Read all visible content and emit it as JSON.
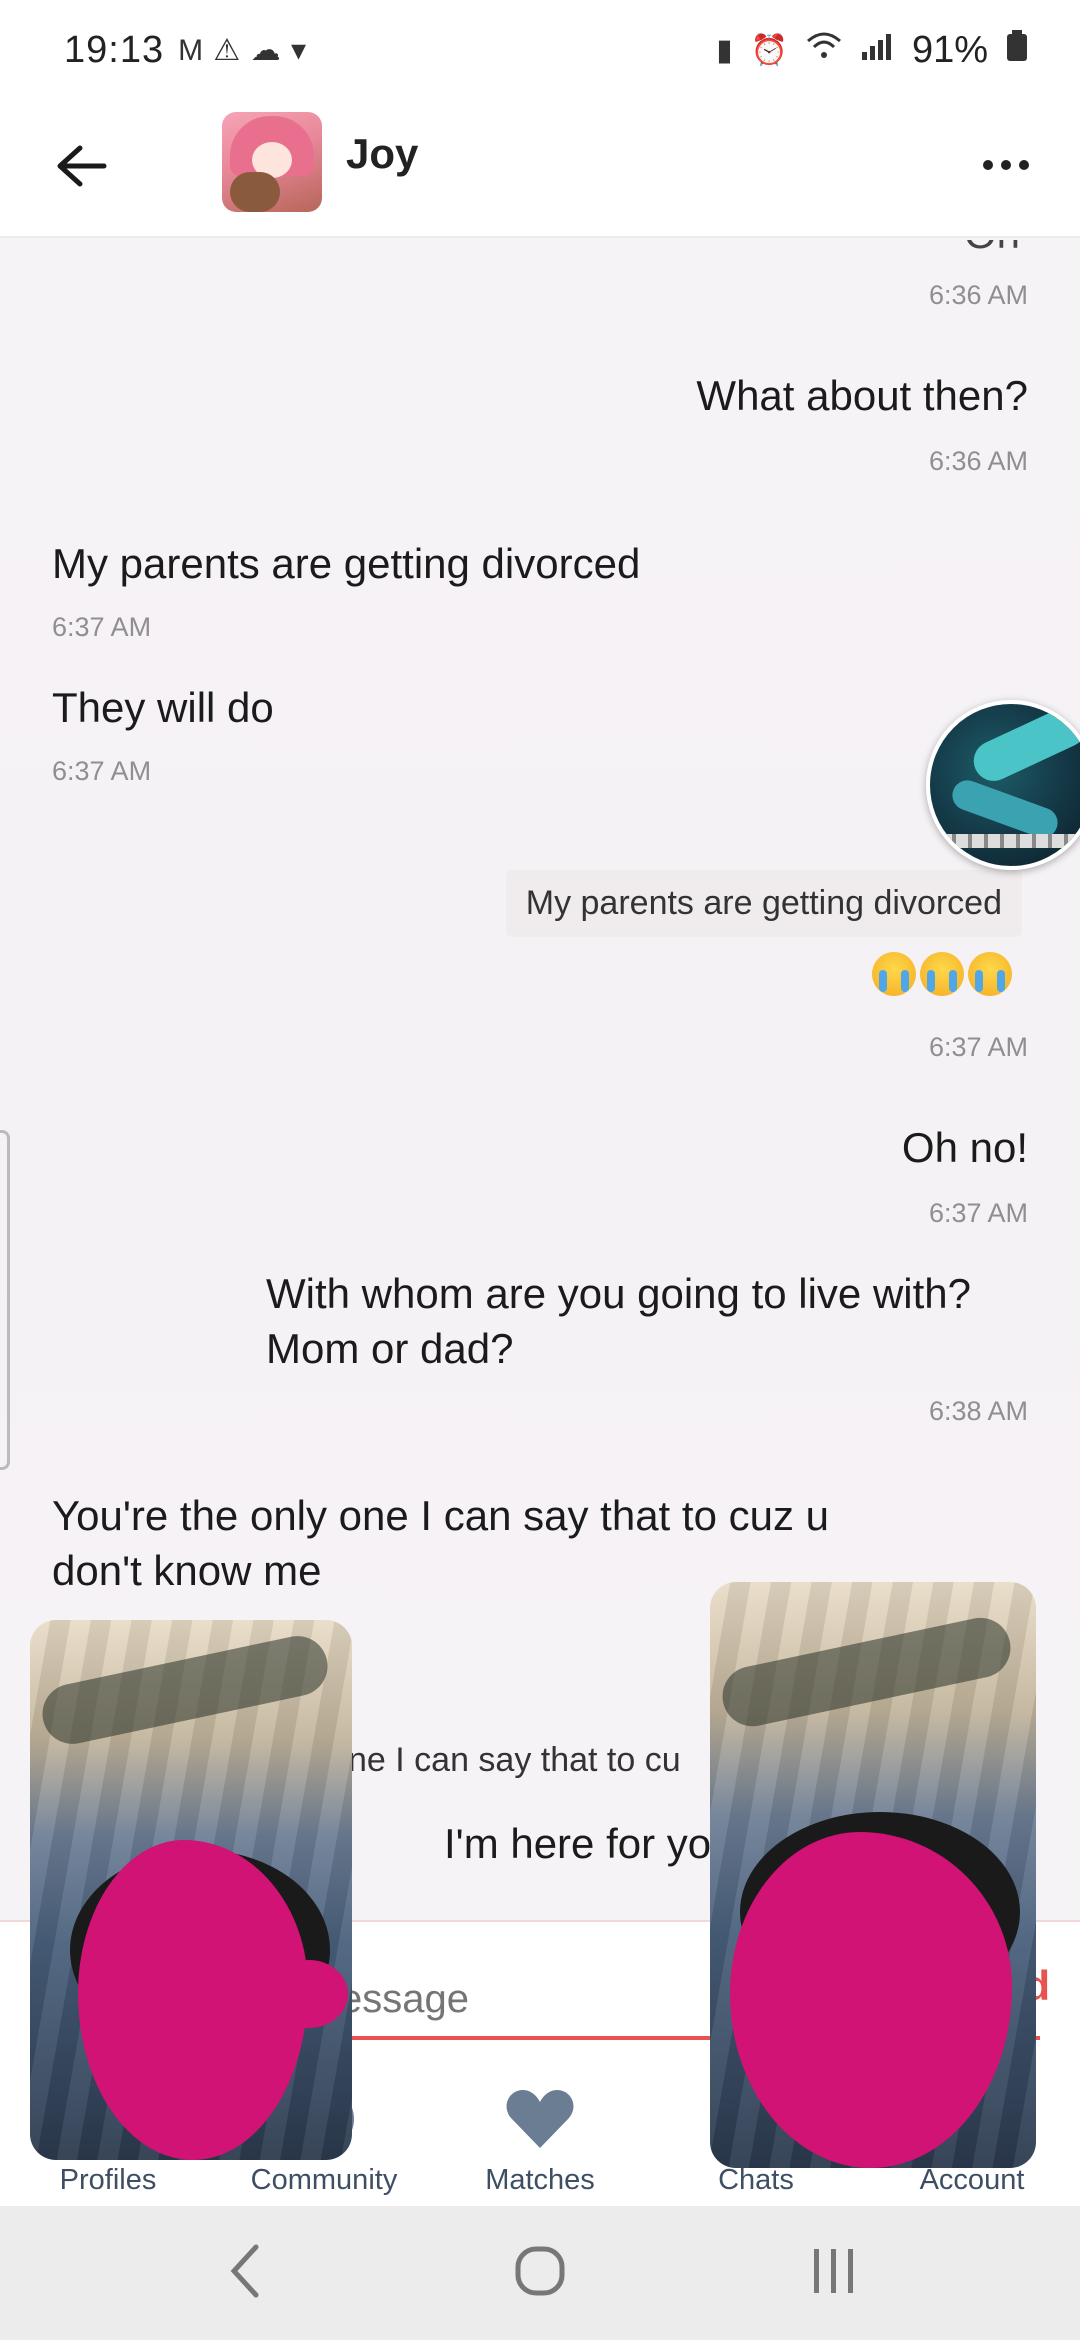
{
  "status_bar": {
    "time": "19:13",
    "left_icons": "M ⚠ ☁ ▾",
    "battery": "91%"
  },
  "header": {
    "contact_name": "Joy"
  },
  "messages": [
    {
      "text": "6:36 AM",
      "kind": "time"
    },
    {
      "text": "What about then?",
      "side": "right"
    },
    {
      "text": "6:36 AM",
      "kind": "time"
    },
    {
      "text": "My parents are getting divorced",
      "side": "left"
    },
    {
      "text": "6:37 AM",
      "kind": "time"
    },
    {
      "text": "They will do",
      "side": "left"
    },
    {
      "text": "6:37 AM",
      "kind": "time"
    },
    {
      "quote": "My parents are getting divorced",
      "emoji": "😭😭😭",
      "side": "right"
    },
    {
      "text": "6:37 AM",
      "kind": "time"
    },
    {
      "text": "Oh no!",
      "side": "right"
    },
    {
      "text": "6:37 AM",
      "kind": "time"
    },
    {
      "text": "With whom are you going to live with? Mom or dad?",
      "side": "right"
    },
    {
      "text": "6:38 AM",
      "kind": "time"
    },
    {
      "text": "You're the only one I can say that to cuz u don't know me",
      "side": "left"
    },
    {
      "text": "ne I can say that to cu",
      "kind": "partial-quote"
    },
    {
      "text": "I'm here for yo",
      "kind": "partial"
    }
  ],
  "input": {
    "placeholder": "essage",
    "send_label": "d"
  },
  "bottom_nav": {
    "items": [
      {
        "label": "Profiles"
      },
      {
        "label": "Community"
      },
      {
        "label": "Matches"
      },
      {
        "label": "Chats"
      },
      {
        "label": "Account"
      }
    ]
  },
  "colors": {
    "accent": "#e8534f",
    "nav_icon": "#6a7d93",
    "redaction": "#d01374"
  }
}
